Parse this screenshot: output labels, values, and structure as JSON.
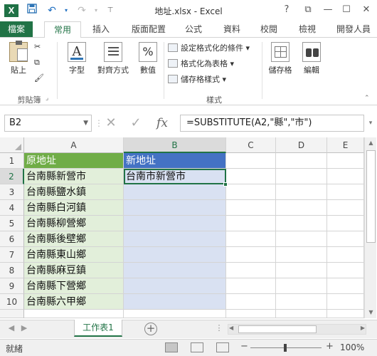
{
  "app": {
    "window_title": "地址.xlsx - Excel",
    "logo": "X",
    "help": "?",
    "restore": "⧉",
    "minimize": "—",
    "maximize": "☐",
    "close": "✕"
  },
  "ribbon_tabs": [
    "檔案",
    "常用",
    "插入",
    "版面配置",
    "公式",
    "資料",
    "校閱",
    "檢視",
    "開發人員"
  ],
  "ribbon": {
    "paste": "貼上",
    "clipboard_group": "剪貼簿",
    "font": "字型",
    "alignment": "對齊方式",
    "number": "數值",
    "conditional_format": "設定格式化的條件",
    "format_as_table": "格式化為表格",
    "cell_styles": "儲存格樣式",
    "styles_group": "樣式",
    "cells": "儲存格",
    "editing": "編輯"
  },
  "formula_bar": {
    "name_box": "B2",
    "fx": "fx",
    "formula": "=SUBSTITUTE(A2,\"縣\",\"市\")"
  },
  "columns": [
    "A",
    "B",
    "C",
    "D",
    "E"
  ],
  "rows": [
    "1",
    "2",
    "3",
    "4",
    "5",
    "6",
    "7",
    "8",
    "9",
    "10"
  ],
  "cells": {
    "A": [
      "原地址",
      "台南縣新營市",
      "台南縣鹽水鎮",
      "台南縣白河鎮",
      "台南縣柳營鄉",
      "台南縣後壁鄉",
      "台南縣東山鄉",
      "台南縣麻豆鎮",
      "台南縣下營鄉",
      "台南縣六甲鄉"
    ],
    "B": [
      "新地址",
      "台南市新營市",
      "",
      "",
      "",
      "",
      "",
      "",
      "",
      ""
    ]
  },
  "sheet_tab": "工作表1",
  "status": {
    "ready": "就緒",
    "zoom": "100%"
  },
  "colors": {
    "excel_green": "#217346",
    "header_a": "#70ad47",
    "header_b": "#4472c4",
    "fill_a": "#e2efda",
    "fill_b": "#d9e1f2"
  }
}
